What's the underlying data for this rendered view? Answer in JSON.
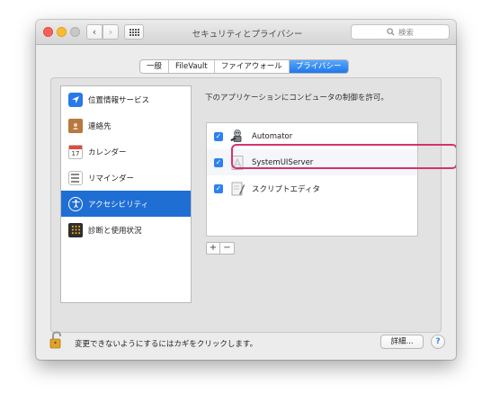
{
  "window": {
    "title": "セキュリティとプライバシー",
    "search_placeholder": "検索"
  },
  "tabs": [
    {
      "label": "一般"
    },
    {
      "label": "FileVault"
    },
    {
      "label": "ファイアウォール"
    },
    {
      "label": "プライバシー",
      "active": true
    }
  ],
  "sidebar": {
    "items": [
      {
        "label": "位置情報サービス",
        "icon": "location-arrow-icon"
      },
      {
        "label": "連絡先",
        "icon": "contacts-book-icon"
      },
      {
        "label": "カレンダー",
        "icon": "calendar-icon",
        "calendar_day": "17"
      },
      {
        "label": "リマインダー",
        "icon": "reminders-list-icon"
      },
      {
        "label": "アクセシビリティ",
        "icon": "accessibility-icon",
        "active": true
      },
      {
        "label": "診断と使用状況",
        "icon": "diagnostics-icon"
      }
    ]
  },
  "content": {
    "heading": "下のアプリケーションにコンピュータの制御を許可。",
    "apps": [
      {
        "name": "Automator",
        "checked": true,
        "icon": "automator-robot-icon"
      },
      {
        "name": "SystemUIServer",
        "checked": true,
        "icon": "system-ui-server-icon"
      },
      {
        "name": "スクリプトエディタ",
        "checked": true,
        "icon": "script-editor-icon"
      }
    ],
    "add_label": "+",
    "remove_label": "−"
  },
  "footer": {
    "lock_text": "変更できないようにするにはカギをクリックします。",
    "details_label": "詳細...",
    "help_label": "?"
  },
  "colors": {
    "accent": "#1f6ed4",
    "highlight": "#d6326b",
    "checkbox": "#2d82f0"
  }
}
